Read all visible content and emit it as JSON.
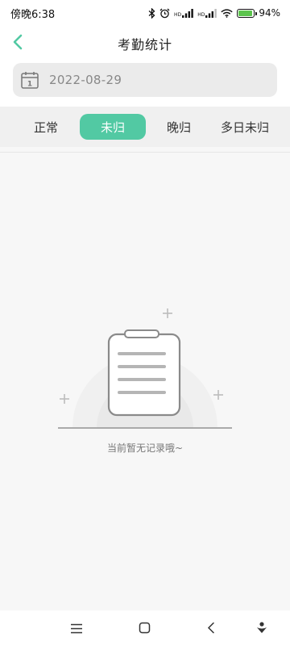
{
  "status_bar": {
    "time": "傍晚6:38",
    "battery_percent": "94%",
    "battery_level": 0.94,
    "signal_label_1": "HD",
    "signal_label_2": "HD"
  },
  "header": {
    "title": "考勤统计",
    "back_icon": "chevron-left-icon"
  },
  "date_filter": {
    "icon": "calendar-icon",
    "calendar_day": "1",
    "value": "2022-08-29"
  },
  "tabs": [
    {
      "label": "正常",
      "active": false
    },
    {
      "label": "未归",
      "active": true
    },
    {
      "label": "晚归",
      "active": false
    },
    {
      "label": "多日未归",
      "active": false
    }
  ],
  "empty_state": {
    "icon": "clipboard-icon",
    "message": "当前暂无记录哦~"
  },
  "nav_bar": {
    "icons": [
      "menu-icon",
      "home-icon",
      "back-icon",
      "assistant-icon"
    ]
  },
  "colors": {
    "accent": "#52c9a3",
    "background": "#f7f7f7",
    "tab_bar": "#f0f0f0"
  }
}
